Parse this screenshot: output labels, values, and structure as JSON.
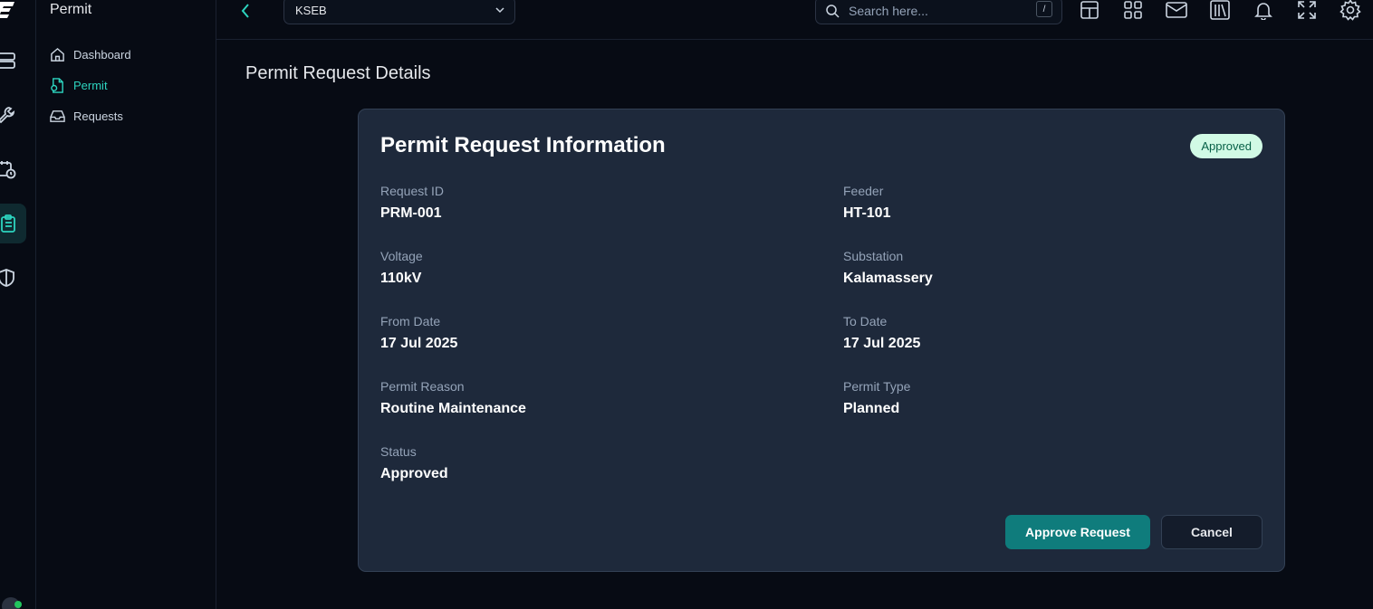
{
  "app": {
    "section_title": "Permit"
  },
  "sidebar": {
    "items": [
      {
        "label": "Dashboard",
        "icon": "home-icon"
      },
      {
        "label": "Permit",
        "icon": "permit-file-icon",
        "active": true
      },
      {
        "label": "Requests",
        "icon": "inbox-icon"
      }
    ]
  },
  "topbar": {
    "selected_org": "KSEB",
    "search_placeholder": "Search here...",
    "search_shortcut": "/"
  },
  "page": {
    "title": "Permit Request Details"
  },
  "card": {
    "title": "Permit Request Information",
    "badge": "Approved",
    "fields": [
      {
        "label": "Request ID",
        "value": "PRM-001"
      },
      {
        "label": "Feeder",
        "value": "HT-101"
      },
      {
        "label": "Voltage",
        "value": "110kV"
      },
      {
        "label": "Substation",
        "value": "Kalamassery"
      },
      {
        "label": "From Date",
        "value": "17 Jul 2025"
      },
      {
        "label": "To Date",
        "value": "17 Jul 2025"
      },
      {
        "label": "Permit Reason",
        "value": "Routine Maintenance"
      },
      {
        "label": "Permit Type",
        "value": "Planned"
      },
      {
        "label": "Status",
        "value": "Approved"
      }
    ],
    "approve_label": "Approve Request",
    "cancel_label": "Cancel"
  },
  "colors": {
    "accent": "#2dd4bf",
    "primary_button": "#0f7c7c",
    "badge_bg": "#d1fae5",
    "badge_text": "#065f46"
  }
}
